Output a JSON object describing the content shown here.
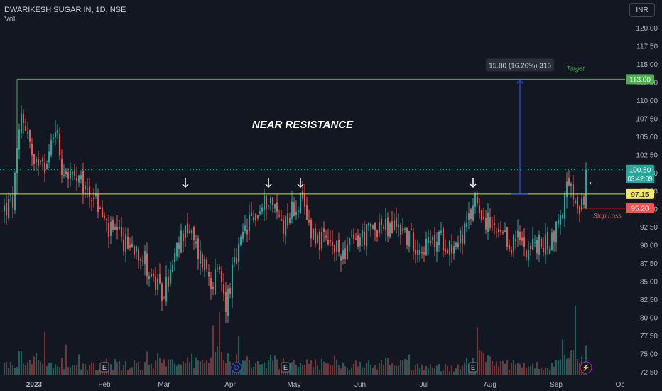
{
  "header": {
    "symbol": "DWARIKESH SUGAR IN, 1D, NSE",
    "vol": "Vol",
    "currency": "INR"
  },
  "colors": {
    "bg": "#131722",
    "up": "#26a69a",
    "down": "#ef5350",
    "target": "#4caf50",
    "resist": "#c8e25a",
    "vol_up": "#1f6d67",
    "vol_down": "#8a3a3a"
  },
  "annotations": {
    "title": "NEAR RESISTANCE",
    "target_label": "Target",
    "stoploss_label": "Stop Loss",
    "measure_label": "15.80 (16.26%) 316",
    "arrow_left": "←"
  },
  "price_tags": {
    "target": {
      "value": 113.0,
      "text": "113.00"
    },
    "current": {
      "value": 100.5,
      "text": "100.50",
      "timer": "03:42:09"
    },
    "resistance": {
      "value": 97.15,
      "text": "97.15"
    },
    "stoploss": {
      "value": 95.2,
      "text": "95.20"
    }
  },
  "chart_data": {
    "type": "candlestick",
    "symbol": "DWARIKESH SUGAR IN",
    "interval": "1D",
    "exchange": "NSE",
    "ylim": [
      72.5,
      122.5
    ],
    "y_ticks": [
      72.5,
      75,
      77.5,
      80,
      82.5,
      85,
      87.5,
      90,
      92.5,
      95,
      97.5,
      100,
      102.5,
      105,
      107.5,
      110,
      112.5,
      115,
      117.5,
      120
    ],
    "y_tick_labels": [
      "72.50",
      "75.00",
      "77.50",
      "80.00",
      "82.50",
      "85.00",
      "87.50",
      "90.00",
      "92.50",
      "95.00",
      "97.50",
      "100.00",
      "102.50",
      "105.00",
      "107.50",
      "110.00",
      "112.50",
      "115.00",
      "117.50",
      "120.00"
    ],
    "x_ticks": [
      {
        "label": "2023",
        "day": 14
      },
      {
        "label": "Feb",
        "day": 47
      },
      {
        "label": "Mar",
        "day": 75
      },
      {
        "label": "Apr",
        "day": 106
      },
      {
        "label": "May",
        "day": 136
      },
      {
        "label": "Jun",
        "day": 167
      },
      {
        "label": "Jul",
        "day": 197
      },
      {
        "label": "Aug",
        "day": 228
      },
      {
        "label": "Sep",
        "day": 259
      },
      {
        "label": "Oc",
        "day": 289
      }
    ],
    "x_range": [
      0,
      290
    ],
    "levels": {
      "target": 113.0,
      "resistance": 97.15,
      "stoploss": 95.2,
      "current": 100.5
    },
    "events": [
      {
        "type": "E",
        "day": 47
      },
      {
        "type": "D",
        "day": 109
      },
      {
        "type": "E",
        "day": 132
      },
      {
        "type": "E",
        "day": 220
      },
      {
        "type": "S",
        "day": 273
      }
    ],
    "touch_arrows": [
      {
        "day": 85
      },
      {
        "day": 124
      },
      {
        "day": 139
      },
      {
        "day": 220
      }
    ],
    "measure": {
      "day": 242,
      "from": 97.15,
      "to": 113.0
    },
    "anchors": [
      [
        0,
        95,
        0.3
      ],
      [
        4,
        96,
        0.25
      ],
      [
        6,
        102,
        0.55
      ],
      [
        8,
        108,
        0.35
      ],
      [
        11,
        106,
        0.45
      ],
      [
        14,
        100,
        0.4
      ],
      [
        17,
        103,
        0.35
      ],
      [
        20,
        101,
        0.3
      ],
      [
        24,
        107,
        0.4
      ],
      [
        27,
        101,
        0.3
      ],
      [
        30,
        100,
        0.3
      ],
      [
        33,
        99,
        0.25
      ],
      [
        37,
        98,
        0.28
      ],
      [
        42,
        97,
        0.25
      ],
      [
        46,
        94,
        0.35
      ],
      [
        49,
        92,
        0.3
      ],
      [
        54,
        91,
        0.3
      ],
      [
        58,
        90,
        0.3
      ],
      [
        62,
        90,
        0.28
      ],
      [
        66,
        88,
        0.3
      ],
      [
        70,
        85,
        0.45
      ],
      [
        74,
        83,
        0.35
      ],
      [
        78,
        86,
        0.3
      ],
      [
        82,
        90,
        0.35
      ],
      [
        85,
        93,
        0.45
      ],
      [
        88,
        91,
        0.35
      ],
      [
        91,
        89,
        0.3
      ],
      [
        95,
        87,
        0.35
      ],
      [
        98,
        85,
        0.55
      ],
      [
        101,
        86,
        0.45
      ],
      [
        104,
        82,
        0.55
      ],
      [
        107,
        86,
        0.4
      ],
      [
        110,
        89,
        0.35
      ],
      [
        113,
        92,
        0.4
      ],
      [
        117,
        94,
        0.4
      ],
      [
        121,
        95,
        0.35
      ],
      [
        124,
        97,
        0.4
      ],
      [
        127,
        95,
        0.35
      ],
      [
        131,
        93,
        0.35
      ],
      [
        135,
        95,
        0.35
      ],
      [
        139,
        96,
        0.4
      ],
      [
        143,
        93,
        0.35
      ],
      [
        147,
        91,
        0.3
      ],
      [
        152,
        90,
        0.3
      ],
      [
        157,
        89,
        0.28
      ],
      [
        162,
        90,
        0.28
      ],
      [
        167,
        91,
        0.3
      ],
      [
        172,
        92,
        0.3
      ],
      [
        176,
        93,
        0.35
      ],
      [
        180,
        92,
        0.3
      ],
      [
        185,
        93,
        0.3
      ],
      [
        190,
        91,
        0.25
      ],
      [
        195,
        90,
        0.25
      ],
      [
        200,
        90,
        0.22
      ],
      [
        205,
        91,
        0.22
      ],
      [
        210,
        90,
        0.22
      ],
      [
        214,
        91,
        0.25
      ],
      [
        218,
        93,
        0.4
      ],
      [
        221,
        97,
        0.45
      ],
      [
        225,
        94,
        0.4
      ],
      [
        229,
        92,
        0.3
      ],
      [
        233,
        91,
        0.28
      ],
      [
        237,
        90,
        0.28
      ],
      [
        241,
        91,
        0.28
      ],
      [
        245,
        90,
        0.25
      ],
      [
        249,
        90,
        0.25
      ],
      [
        253,
        90,
        0.25
      ],
      [
        257,
        91,
        0.3
      ],
      [
        261,
        94,
        0.5
      ],
      [
        264,
        98,
        0.6
      ],
      [
        267,
        97,
        0.55
      ],
      [
        270,
        93,
        0.55
      ],
      [
        272,
        97,
        0.6
      ],
      [
        273,
        100.5,
        0.75
      ]
    ]
  }
}
